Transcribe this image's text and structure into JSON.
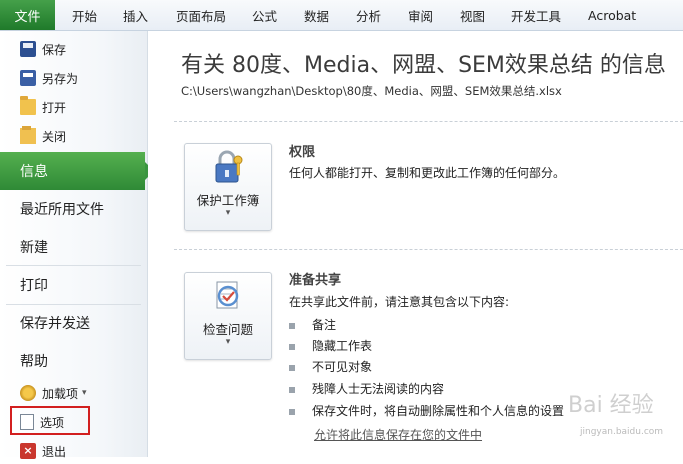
{
  "ribbon": {
    "file_tab": "文件",
    "tabs": [
      "开始",
      "插入",
      "页面布局",
      "公式",
      "数据",
      "分析",
      "审阅",
      "视图",
      "开发工具",
      "Acrobat"
    ]
  },
  "nav": {
    "save": "保存",
    "save_as": "另存为",
    "open": "打开",
    "close": "关闭",
    "info": "信息",
    "recent": "最近所用文件",
    "new": "新建",
    "print": "打印",
    "save_send": "保存并发送",
    "help": "帮助",
    "addins": "加载项",
    "addins_arrow": "▾",
    "options": "选项",
    "exit": "退出"
  },
  "main": {
    "title": "有关 80度、Media、网盟、SEM效果总结 的信息",
    "path": "C:\\Users\\wangzhan\\Desktop\\80度、Media、网盟、SEM效果总结.xlsx",
    "permissions": {
      "button_label": "保护工作簿",
      "button_arrow": "▾",
      "heading": "权限",
      "text": "任何人都能打开、复制和更改此工作簿的任何部分。"
    },
    "prepare": {
      "button_label": "检查问题",
      "button_arrow": "▾",
      "heading": "准备共享",
      "text": "在共享此文件前，请注意其包含以下内容:",
      "items": [
        "备注",
        "隐藏工作表",
        "不可见对象",
        "残障人士无法阅读的内容",
        "保存文件时，将自动删除属性和个人信息的设置"
      ],
      "link": "允许将此信息保存在您的文件中"
    },
    "watermark": "Bai 经验",
    "watermark_url": "jingyan.baidu.com"
  },
  "colors": {
    "file_green": "#2f8a36",
    "highlight_red": "#d21f1f"
  }
}
